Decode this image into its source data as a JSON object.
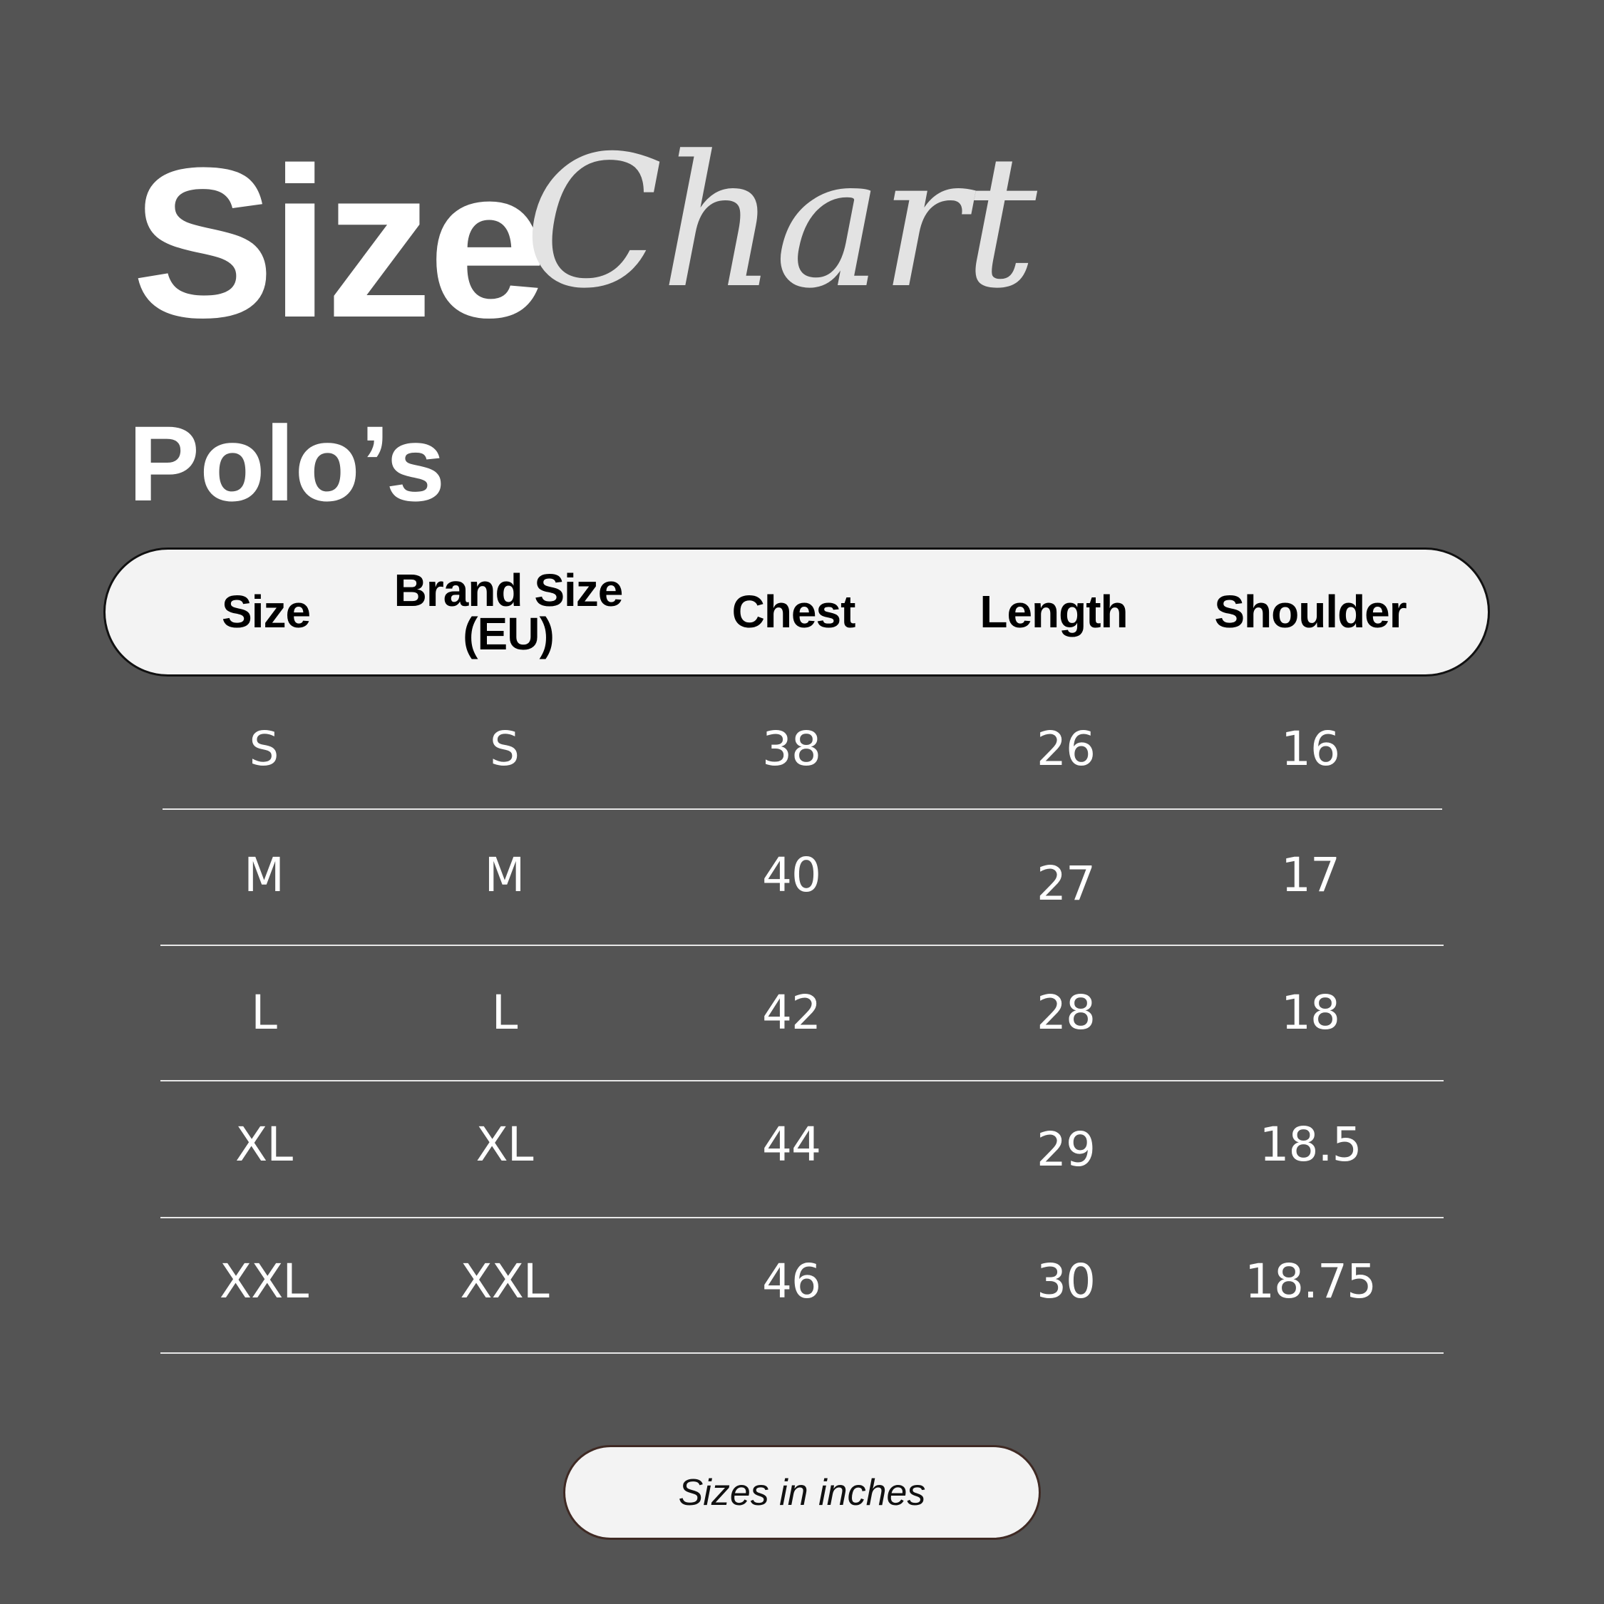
{
  "title": {
    "word1": "Size",
    "word2": "Chart"
  },
  "category": "Polo’s",
  "table": {
    "headers": {
      "size": "Size",
      "brand_size_line1": "Brand Size",
      "brand_size_line2": "(EU)",
      "chest": "Chest",
      "length": "Length",
      "shoulder": "Shoulder"
    },
    "rows": [
      {
        "size": "S",
        "brand_size": "S",
        "chest": "38",
        "length": "26",
        "shoulder": "16"
      },
      {
        "size": "M",
        "brand_size": "M",
        "chest": "40",
        "length": "27",
        "shoulder": "17"
      },
      {
        "size": "L",
        "brand_size": "L",
        "chest": "42",
        "length": "28",
        "shoulder": "18"
      },
      {
        "size": "XL",
        "brand_size": "XL",
        "chest": "44",
        "length": "29",
        "shoulder": "18.5"
      },
      {
        "size": "XXL",
        "brand_size": "XXL",
        "chest": "46",
        "length": "30",
        "shoulder": "18.75"
      }
    ]
  },
  "footer": {
    "note": "Sizes in inches"
  },
  "colors": {
    "background": "#545454",
    "pill": "#f3f3f3",
    "title_script": "#e3e3e3",
    "divider": "#e8e8e8"
  }
}
